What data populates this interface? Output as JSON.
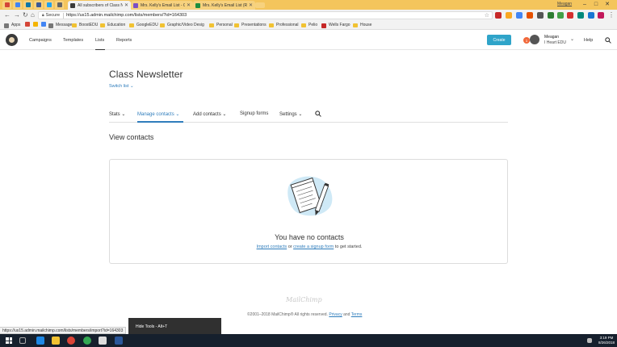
{
  "browser": {
    "tabs": [
      {
        "label": "All subscribers of Class N",
        "active": true,
        "favicon_color": "#3a3a3a"
      },
      {
        "label": "Mrs. Kelly's Email List - G",
        "active": false,
        "favicon_color": "#7b4fc4"
      },
      {
        "label": "Mrs. Kelly's Email List (Re",
        "active": false,
        "favicon_color": "#1e8e3e"
      }
    ],
    "window_user": "Meagan",
    "address": {
      "secure_label": "Secure",
      "url": "https://us15.admin.mailchimp.com/lists/members/?id=164303"
    },
    "bookmarks": [
      {
        "label": "Apps",
        "type": "apps"
      },
      {
        "label": "",
        "type": "gmail"
      },
      {
        "label": "",
        "type": "drive"
      },
      {
        "label": "",
        "type": "mail"
      },
      {
        "label": "Messages",
        "type": "app"
      },
      {
        "label": "BoostEDU",
        "type": "folder"
      },
      {
        "label": "Education",
        "type": "folder"
      },
      {
        "label": "GoogleEDU",
        "type": "folder"
      },
      {
        "label": "Graphic/Video Desig",
        "type": "folder"
      },
      {
        "label": "Personal",
        "type": "folder"
      },
      {
        "label": "Presentations",
        "type": "folder"
      },
      {
        "label": "Professional",
        "type": "folder"
      },
      {
        "label": "Pelio",
        "type": "folder"
      },
      {
        "label": "Wells Fargo",
        "type": "site"
      },
      {
        "label": "House",
        "type": "folder"
      }
    ]
  },
  "mc_nav": {
    "links": [
      "Campaigns",
      "Templates",
      "Lists",
      "Reports"
    ],
    "active_link": "Lists",
    "create_label": "Create",
    "notification_count": "1",
    "account_name": "Meagan",
    "account_org": "I Heart EDU",
    "help_label": "Help"
  },
  "page": {
    "list_title": "Class Newsletter",
    "switch_list": "Switch list",
    "subnav": [
      {
        "label": "Stats",
        "dropdown": true,
        "active": false
      },
      {
        "label": "Manage contacts",
        "dropdown": true,
        "active": true
      },
      {
        "label": "Add contacts",
        "dropdown": true,
        "active": false
      },
      {
        "label": "Signup forms",
        "dropdown": false,
        "active": false
      },
      {
        "label": "Settings",
        "dropdown": true,
        "active": false
      }
    ],
    "section_title": "View contacts",
    "empty": {
      "title": "You have no contacts",
      "import_link": "Import contacts",
      "or_text": "or",
      "signup_link": "create a signup form",
      "tail_text": "to get started."
    }
  },
  "footer": {
    "logo_text": "MailChimp",
    "copyright": "©2001–2018 MailChimp® All rights reserved.",
    "privacy": "Privacy",
    "and": "and",
    "terms": "Terms",
    "hide_tools": "Hide Tools - Alt+T"
  },
  "status_bar_url": "https://us15.admin.mailchimp.com/lists/members/import?id=164303",
  "taskbar": {
    "time": "3:19 PM",
    "date": "8/26/2018"
  },
  "colors": {
    "accent_blue": "#2f7dbc",
    "create_button": "#2fa4c9",
    "chrome_tabbar": "#f4c55c"
  }
}
